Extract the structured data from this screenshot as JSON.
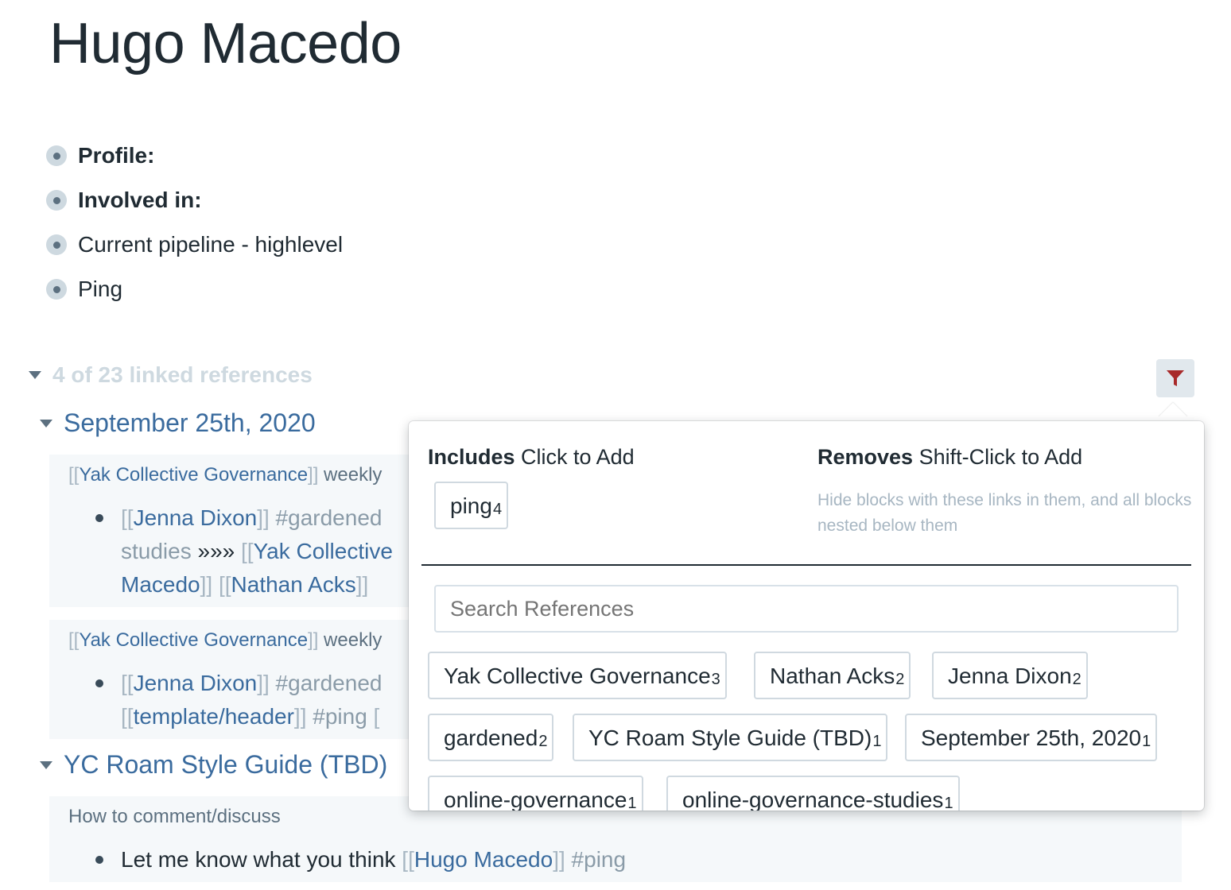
{
  "page": {
    "title": "Hugo Macedo"
  },
  "bullets": [
    {
      "text": "Profile:",
      "bold": true
    },
    {
      "text": "Involved in:",
      "bold": true
    },
    {
      "text": "Current pipeline - highlevel",
      "bold": false
    },
    {
      "text": "Ping",
      "bold": false
    }
  ],
  "linked_refs": {
    "header": "4 of 23 linked references",
    "sections": [
      {
        "title": "September 25th, 2020",
        "blocks": [
          {
            "breadcrumb": {
              "open": "[[",
              "link": "Yak Collective Governance",
              "close": "]]",
              "rest": " weekly"
            },
            "lines": [
              [
                "[[",
                "Jenna Dixon",
                "]]",
                " #gardened"
              ],
              [
                "studies ",
                "»»» ",
                "[[",
                "Yak Collective"
              ],
              [
                "Macedo",
                "]] ",
                "[[",
                "Nathan Acks",
                "]]"
              ]
            ]
          },
          {
            "breadcrumb": {
              "open": "[[",
              "link": "Yak Collective Governance",
              "close": "]]",
              "rest": " weekly"
            },
            "lines": [
              [
                "[[",
                "Jenna Dixon",
                "]]",
                " #gardened"
              ],
              [
                "[[",
                "template/header",
                "]]",
                " #ping",
                " ["
              ]
            ]
          }
        ]
      },
      {
        "title": "YC Roam Style Guide (TBD)",
        "blocks": [
          {
            "breadcrumb_plain": "How to comment/discuss",
            "line": {
              "text": "Let me know what you think ",
              "open": "[[",
              "link": "Hugo Macedo",
              "close": "]]",
              "tag": " #ping"
            }
          }
        ]
      }
    ]
  },
  "filter": {
    "includes_title": "Includes",
    "includes_hint": "Click to Add",
    "removes_title": "Removes",
    "removes_hint": "Shift-Click to Add",
    "removes_desc": "Hide blocks with these links in them, and all blocks nested below them",
    "included": [
      {
        "label": "ping",
        "count": "4"
      }
    ],
    "search_placeholder": "Search References",
    "chips": [
      {
        "label": "Yak Collective Governance",
        "count": "3"
      },
      {
        "label": "Nathan Acks",
        "count": "2"
      },
      {
        "label": "Jenna Dixon",
        "count": "2"
      },
      {
        "label": "gardened",
        "count": "2"
      },
      {
        "label": "YC Roam Style Guide (TBD)",
        "count": "1"
      },
      {
        "label": "September 25th, 2020",
        "count": "1"
      },
      {
        "label": "online-governance",
        "count": "1"
      },
      {
        "label": "online-governance-studies",
        "count": "1"
      }
    ]
  },
  "colors": {
    "link": "#3a6b9e",
    "bracket": "#a7b6c2",
    "filter_icon": "#a82a2a"
  },
  "icons": {
    "filter": "filter-funnel-icon",
    "caret": "caret-down-icon"
  }
}
